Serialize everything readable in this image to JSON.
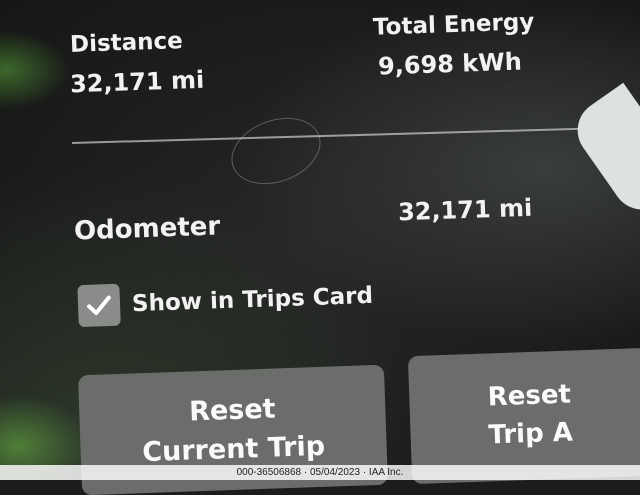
{
  "trip": {
    "distance_label": "Distance",
    "distance_value": "32,171 mi",
    "energy_label": "Total Energy",
    "energy_value": "9,698 kWh"
  },
  "odometer": {
    "label": "Odometer",
    "value": "32,171 mi"
  },
  "show_in_trips_card": {
    "label": "Show in Trips Card",
    "checked": true
  },
  "buttons": {
    "reset_current_line1": "Reset",
    "reset_current_line2": "Current Trip",
    "reset_tripa_line1": "Reset",
    "reset_tripa_line2": "Trip A"
  },
  "watermark": "000-36506868 · 05/04/2023 · IAA Inc.",
  "colors": {
    "background": "#1b1c1b",
    "button": "#6b6d6b",
    "checkbox": "#8a8c8a",
    "text": "#f2f2f2"
  }
}
